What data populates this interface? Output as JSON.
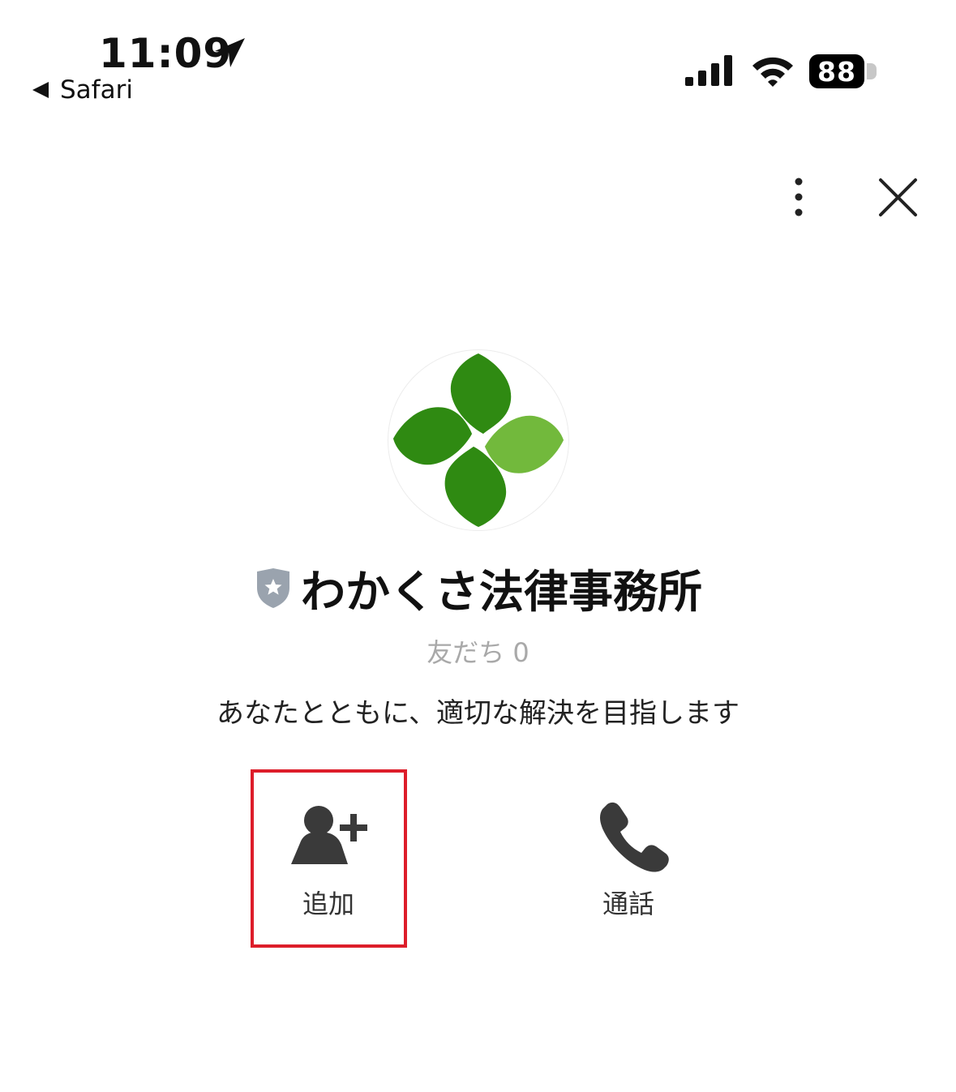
{
  "status_bar": {
    "time": "11:09",
    "back_app": "Safari",
    "battery": "88"
  },
  "profile": {
    "name": "わかくさ法律事務所",
    "friends": "友だち 0",
    "status_message": "あなたとともに、適切な解決を目指します"
  },
  "actions": {
    "add_label": "追加",
    "call_label": "通話"
  },
  "icons": {
    "location": "location-arrow-icon",
    "signal": "cellular-signal-icon",
    "wifi": "wifi-icon",
    "more": "more-vertical-icon",
    "close": "close-icon",
    "badge": "verified-shield-icon",
    "add": "add-friend-icon",
    "call": "phone-icon"
  },
  "colors": {
    "highlight": "#dd1d2a",
    "leaf_dark": "#2f8a12",
    "leaf_light": "#72b93c",
    "icon_gray": "#3a3a3a"
  }
}
